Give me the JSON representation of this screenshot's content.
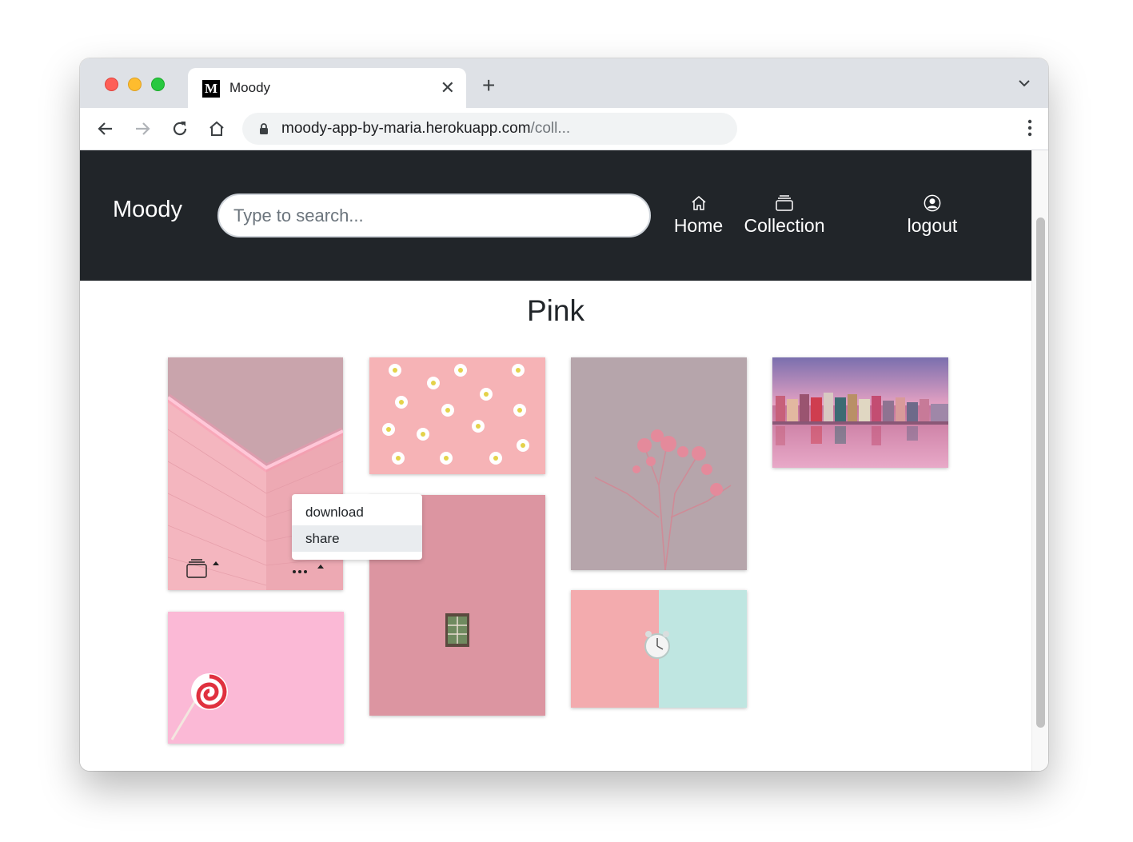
{
  "browser": {
    "tab_title": "Moody",
    "favicon_letter": "M",
    "url_host": "moody-app-by-maria.herokuapp.com",
    "url_path": "/coll..."
  },
  "navbar": {
    "brand": "Moody",
    "search_placeholder": "Type to search...",
    "links": [
      {
        "label": "Home",
        "icon": "home-icon"
      },
      {
        "label": "Collection",
        "icon": "collection-icon"
      },
      {
        "label": "logout",
        "icon": "user-circle-icon"
      }
    ]
  },
  "page": {
    "title": "Pink"
  },
  "image_menu": {
    "items": [
      "download",
      "share"
    ],
    "highlighted": "share"
  },
  "images": [
    {
      "subject": "pink neon-lit tiled corner",
      "icon": "photo"
    },
    {
      "subject": "daisies on pink background",
      "icon": "photo"
    },
    {
      "subject": "pink flowers on mauve background",
      "icon": "photo"
    },
    {
      "subject": "pink sunset harbor with colorful houses",
      "icon": "photo"
    },
    {
      "subject": "swirl lollipop on pink background",
      "icon": "photo"
    },
    {
      "subject": "pink wall with small green window",
      "icon": "photo"
    },
    {
      "subject": "alarm clock on pink and mint background",
      "icon": "photo"
    }
  ],
  "colors": {
    "navbar_bg": "#212529",
    "accent_pink": "#f3b4bb"
  }
}
